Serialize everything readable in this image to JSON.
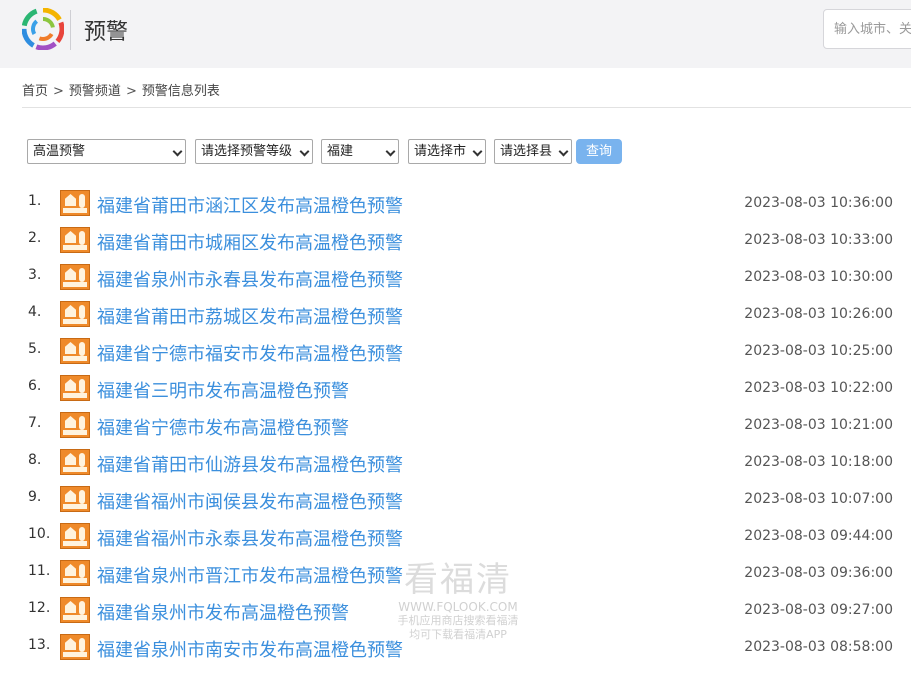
{
  "header": {
    "title": "预警",
    "search_placeholder": "输入城市、关"
  },
  "breadcrumb": {
    "items": [
      "首页",
      "预警频道",
      "预警信息列表"
    ],
    "separator": ">"
  },
  "filters": {
    "type": "高温预警",
    "level": "请选择预警等级",
    "province": "福建",
    "city": "请选择市",
    "county": "请选择县",
    "query_label": "查询"
  },
  "warnings": [
    {
      "num": "1.",
      "title": "福建省莆田市涵江区发布高温橙色预警",
      "time": "2023-08-03 10:36:00"
    },
    {
      "num": "2.",
      "title": "福建省莆田市城厢区发布高温橙色预警",
      "time": "2023-08-03 10:33:00"
    },
    {
      "num": "3.",
      "title": "福建省泉州市永春县发布高温橙色预警",
      "time": "2023-08-03 10:30:00"
    },
    {
      "num": "4.",
      "title": "福建省莆田市荔城区发布高温橙色预警",
      "time": "2023-08-03 10:26:00"
    },
    {
      "num": "5.",
      "title": "福建省宁德市福安市发布高温橙色预警",
      "time": "2023-08-03 10:25:00"
    },
    {
      "num": "6.",
      "title": "福建省三明市发布高温橙色预警",
      "time": "2023-08-03 10:22:00"
    },
    {
      "num": "7.",
      "title": "福建省宁德市发布高温橙色预警",
      "time": "2023-08-03 10:21:00"
    },
    {
      "num": "8.",
      "title": "福建省莆田市仙游县发布高温橙色预警",
      "time": "2023-08-03 10:18:00"
    },
    {
      "num": "9.",
      "title": "福建省福州市闽侯县发布高温橙色预警",
      "time": "2023-08-03 10:07:00"
    },
    {
      "num": "10.",
      "title": "福建省福州市永泰县发布高温橙色预警",
      "time": "2023-08-03 09:44:00"
    },
    {
      "num": "11.",
      "title": "福建省泉州市晋江市发布高温橙色预警",
      "time": "2023-08-03 09:36:00"
    },
    {
      "num": "12.",
      "title": "福建省泉州市发布高温橙色预警",
      "time": "2023-08-03 09:27:00"
    },
    {
      "num": "13.",
      "title": "福建省泉州市南安市发布高温橙色预警",
      "time": "2023-08-03 08:58:00"
    }
  ],
  "icons": {
    "logo": "rainbow-swirl-logo",
    "warning": "orange-heat-warning-icon"
  },
  "colors": {
    "link": "#3b8fdd",
    "button": "#79b3ee",
    "warning_orange": "#ef8a2a",
    "header_bg": "#f3f3f5"
  },
  "watermark": {
    "brand": "看福清",
    "url": "WWW.FQLOOK.COM",
    "line1": "手机应用商店搜索看福清",
    "line2": "均可下载看福清APP"
  }
}
